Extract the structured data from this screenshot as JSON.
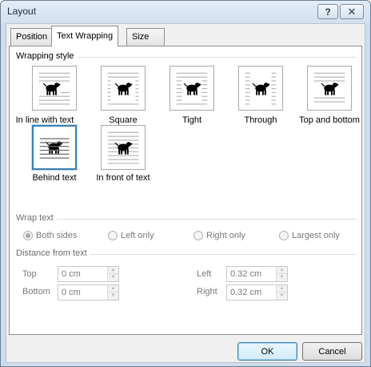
{
  "window": {
    "title": "Layout",
    "help_glyph": "?",
    "close_glyph": "✕"
  },
  "tabs": [
    {
      "label": "Position",
      "active": false
    },
    {
      "label": "Text Wrapping",
      "active": true
    },
    {
      "label": "Size",
      "active": false
    }
  ],
  "wrapping_style": {
    "heading": "Wrapping style",
    "options": [
      {
        "label": "In line with text",
        "icon": "dog-inline-icon",
        "selected": false
      },
      {
        "label": "Square",
        "icon": "dog-square-icon",
        "selected": false
      },
      {
        "label": "Tight",
        "icon": "dog-tight-icon",
        "selected": false
      },
      {
        "label": "Through",
        "icon": "dog-through-icon",
        "selected": false
      },
      {
        "label": "Top and bottom",
        "icon": "dog-topbottom-icon",
        "selected": false
      },
      {
        "label": "Behind text",
        "icon": "dog-behind-icon",
        "selected": true
      },
      {
        "label": "In front of text",
        "icon": "dog-infront-icon",
        "selected": false
      }
    ]
  },
  "wrap_text": {
    "heading": "Wrap text",
    "options": [
      "Both sides",
      "Left only",
      "Right only",
      "Largest only"
    ],
    "selected": "Both sides"
  },
  "distance": {
    "heading": "Distance from text",
    "top": {
      "label": "Top",
      "value": "0 cm"
    },
    "bottom": {
      "label": "Bottom",
      "value": "0 cm"
    },
    "left": {
      "label": "Left",
      "value": "0.32 cm"
    },
    "right": {
      "label": "Right",
      "value": "0.32 cm"
    },
    "spin_up": "▲",
    "spin_down": "▼"
  },
  "buttons": {
    "ok": "OK",
    "cancel": "Cancel"
  },
  "colors": {
    "accent": "#3c7fb1",
    "window_bg": "#f0f0f0",
    "frame": "#cfdcec"
  }
}
